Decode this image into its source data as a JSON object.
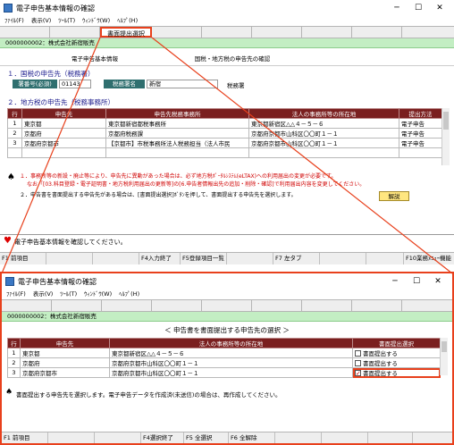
{
  "top": {
    "title": "電子申告基本情報の確認",
    "menu": [
      "ﾌｧｲﾙ(F)",
      "表示(V)",
      "ﾂｰﾙ(T)",
      "ｳｨﾝﾄﾞｳ(W)",
      "ﾍﾙﾌﾟ(H)"
    ],
    "toolbar_button": "書面提出選択",
    "company": "0000000002：株式会社新宿販売",
    "tabs": [
      "電子申告基本情報",
      "国税・地方税の申告先の確認"
    ],
    "sec1": "１．国税の申告先（税務署）",
    "tax_office_code_label": "署番号(必須)",
    "tax_office_code": "01143",
    "tax_office_name_label": "税務署名",
    "tax_office_name": "新宿",
    "tax_office_suffix": "税務署",
    "sec2": "２．地方税の申告先（税務事務所）",
    "table_headers": [
      "行",
      "申告先",
      "申告先税務事務所",
      "法人の事務所等の所在地",
      "提出方法"
    ],
    "rows": [
      {
        "no": "1",
        "dest": "東京都",
        "office": "東京都新宿都税事務所",
        "addr": "東京都新宿区△△４－５－６",
        "method": "電子申告"
      },
      {
        "no": "2",
        "dest": "京都府",
        "office": "京都府税務課",
        "addr": "京都府京都市山科区〇〇町１－１",
        "method": "電子申告"
      },
      {
        "no": "3",
        "dest": "京都府京都市",
        "office": "【京都市】市税事務所法人税務担当（法人市民",
        "addr": "京都府京都市山科区〇〇町１－１",
        "method": "電子申告"
      }
    ],
    "note1": "１．事務所等の新設・廃止等により、申告先に異動があった場合は、必ず地方税ﾎﾟｰﾀﾙｼｽﾃﾑ(eLTAX)への利用届出の変更が必要です。",
    "note1b": "なお「[03.科目登録・電子証明書・地方税利用届出の更新等]の[6.申告者情報出先の追加・削除・確認]で利用届出内容を変更してください。",
    "note2": "２．申告書を書面提出する申告先がある場合は、[書面提出選択]ﾎﾞﾀﾝを押して、書面提出する申告先を選択します。",
    "explain_button": "解説",
    "status": "電子申告基本情報を確認してください。",
    "fkeys": [
      "F1 前項目",
      "F4入力終了",
      "F5登録項目一覧",
      "F7 左タブ",
      "F10業務ﾒﾆｭｰ機能"
    ]
  },
  "popup": {
    "title": "電子申告基本情報の確認",
    "menu": [
      "ﾌｧｲﾙ(F)",
      "表示(V)",
      "ﾂｰﾙ(T)",
      "ｳｨﾝﾄﾞｳ(W)",
      "ﾍﾙﾌﾟ(H)"
    ],
    "company": "0000000002：株式会社新宿販売",
    "heading": "＜ 申告書を書面提出する申告先の選択 ＞",
    "table_headers": [
      "行",
      "申告先",
      "法人の事務所等の所在地",
      "書面提出選択"
    ],
    "rows": [
      {
        "no": "1",
        "dest": "東京都",
        "addr": "東京都新宿区△△４－５－６",
        "label": "書面提出する",
        "checked": false
      },
      {
        "no": "2",
        "dest": "京都府",
        "addr": "京都府京都市山科区〇〇町１－１",
        "label": "書面提出する",
        "checked": false
      },
      {
        "no": "3",
        "dest": "京都府京都市",
        "addr": "京都府京都市山科区〇〇町１－１",
        "label": "書面提出する",
        "checked": true
      }
    ],
    "status": "書面提出する申告先を選択します。電子申告データを作成済(未送信)の場合は、再作成してください。",
    "fkeys": [
      "F1 前項目",
      "F4選択終了",
      "F5 全選択",
      "F6 全解除"
    ]
  },
  "colors": {
    "accent": "#e8401c",
    "header": "#7a1f1f",
    "green": "#c3eec3"
  }
}
